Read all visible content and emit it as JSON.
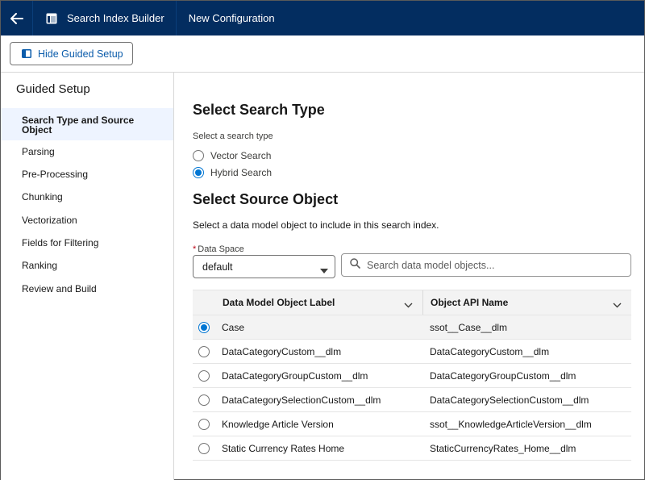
{
  "header": {
    "back_icon": "arrow-left-icon",
    "app_icon": "table-icon",
    "app_name": "Search Index Builder",
    "page_title": "New Configuration",
    "background": "#032d60"
  },
  "toolbar": {
    "hide_button_label": "Hide Guided Setup",
    "hide_button_icon": "panel-left-icon"
  },
  "sidebar": {
    "heading": "Guided Setup",
    "items": [
      {
        "label": "Search Type and Source Object",
        "active": true
      },
      {
        "label": "Parsing",
        "active": false
      },
      {
        "label": "Pre-Processing",
        "active": false
      },
      {
        "label": "Chunking",
        "active": false
      },
      {
        "label": "Vectorization",
        "active": false
      },
      {
        "label": "Fields for Filtering",
        "active": false
      },
      {
        "label": "Ranking",
        "active": false
      },
      {
        "label": "Review and Build",
        "active": false
      }
    ]
  },
  "search_type": {
    "title": "Select Search Type",
    "prompt": "Select a search type",
    "options": [
      {
        "label": "Vector Search",
        "selected": false
      },
      {
        "label": "Hybrid Search",
        "selected": true
      }
    ]
  },
  "source_object": {
    "title": "Select Source Object",
    "description": "Select a data model object to include in this search index.",
    "data_space": {
      "required_mark": "*",
      "label": "Data Space",
      "value": "default"
    },
    "search_placeholder": "Search data model objects...",
    "table": {
      "columns": [
        "Data Model Object Label",
        "Object API Name"
      ],
      "rows": [
        {
          "label": "Case",
          "api_name": "ssot__Case__dlm",
          "selected": true
        },
        {
          "label": "DataCategoryCustom__dlm",
          "api_name": "DataCategoryCustom__dlm",
          "selected": false
        },
        {
          "label": "DataCategoryGroupCustom__dlm",
          "api_name": "DataCategoryGroupCustom__dlm",
          "selected": false
        },
        {
          "label": "DataCategorySelectionCustom__dlm",
          "api_name": "DataCategorySelectionCustom__dlm",
          "selected": false
        },
        {
          "label": "Knowledge Article Version",
          "api_name": "ssot__KnowledgeArticleVersion__dlm",
          "selected": false
        },
        {
          "label": "Static Currency Rates Home",
          "api_name": "StaticCurrencyRates_Home__dlm",
          "selected": false
        }
      ]
    }
  },
  "colors": {
    "accent": "#0176d3",
    "link": "#0b5cab",
    "active_nav_bg": "#eef4ff"
  }
}
